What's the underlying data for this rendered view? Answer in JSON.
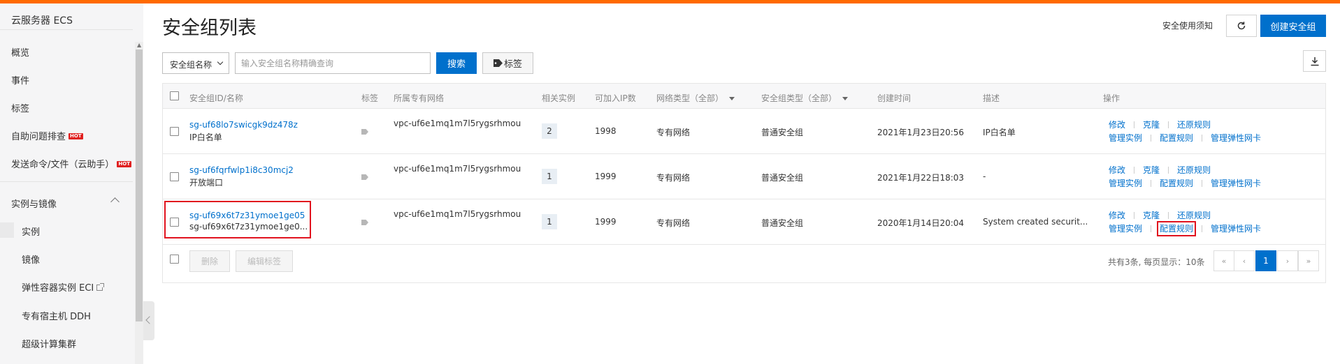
{
  "sidebar": {
    "title": "云服务器 ECS",
    "items": [
      {
        "label": "概览"
      },
      {
        "label": "事件"
      },
      {
        "label": "标签"
      },
      {
        "label": "自助问题排查",
        "badge": "HOT"
      },
      {
        "label": "发送命令/文件（云助手）",
        "badge": "HOT"
      }
    ],
    "section": "实例与镜像",
    "sub_items": [
      {
        "label": "实例"
      },
      {
        "label": "镜像"
      },
      {
        "label": "弹性容器实例 ECI"
      },
      {
        "label": "专有宿主机 DDH"
      },
      {
        "label": "超级计算集群"
      }
    ]
  },
  "header": {
    "title": "安全组列表",
    "notice_link": "安全使用须知",
    "create_button": "创建安全组"
  },
  "search": {
    "field_select": "安全组名称",
    "placeholder": "输入安全组名称精确查询",
    "search_button": "搜索",
    "tags_button": "标签"
  },
  "table": {
    "columns": [
      "安全组ID/名称",
      "标签",
      "所属专有网络",
      "相关实例",
      "可加入IP数",
      "网络类型（全部）",
      "安全组类型（全部）",
      "创建时间",
      "描述",
      "操作"
    ],
    "rows": [
      {
        "id": "sg-uf68lo7swicgk9dz478z",
        "name": "IP白名单",
        "vpc": "vpc-uf6e1mq1m7l5rygsrhmou",
        "instances": "2",
        "ip_count": "1998",
        "network_type": "专有网络",
        "sg_type": "普通安全组",
        "created": "2021年1月23日20:56",
        "desc": "IP白名单"
      },
      {
        "id": "sg-uf6fqrfwlp1i8c30mcj2",
        "name": "开放端口",
        "vpc": "vpc-uf6e1mq1m7l5rygsrhmou",
        "instances": "1",
        "ip_count": "1999",
        "network_type": "专有网络",
        "sg_type": "普通安全组",
        "created": "2021年1月22日18:03",
        "desc": "-"
      },
      {
        "id": "sg-uf69x6t7z31ymoe1ge05",
        "name": "sg-uf69x6t7z31ymoe1ge0...",
        "vpc": "vpc-uf6e1mq1m7l5rygsrhmou",
        "instances": "1",
        "ip_count": "1999",
        "network_type": "专有网络",
        "sg_type": "普通安全组",
        "created": "2020年1月14日20:04",
        "desc": "System created securit..."
      }
    ],
    "actions": {
      "modify": "修改",
      "clone": "克隆",
      "restore": "还原规则",
      "manage_instances": "管理实例",
      "configure_rules": "配置规则",
      "manage_eni": "管理弹性网卡"
    }
  },
  "footer": {
    "delete_button": "删除",
    "edit_tags_button": "编辑标签",
    "pager_info": "共有3条, 每页显示：10条",
    "pager": {
      "first": "«",
      "prev": "‹",
      "current": "1",
      "next": "›",
      "last": "»"
    }
  },
  "colors": {
    "accent": "#0070cc",
    "brand": "#ff6a00",
    "highlight": "#e1121e"
  }
}
